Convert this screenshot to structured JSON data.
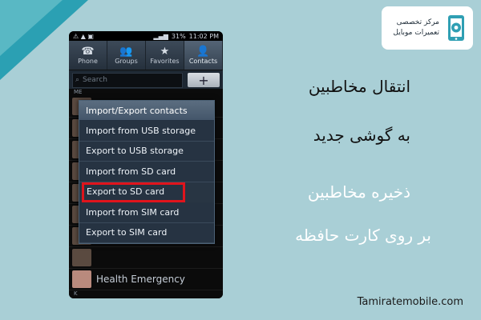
{
  "status": {
    "right_text": "11:02 PM",
    "battery": "31%"
  },
  "tabs": [
    {
      "label": "Phone",
      "icon": "phone-icon",
      "glyph": "☎"
    },
    {
      "label": "Groups",
      "icon": "groups-icon",
      "glyph": "👥"
    },
    {
      "label": "Favorites",
      "icon": "star-icon",
      "glyph": "★"
    },
    {
      "label": "Contacts",
      "icon": "contact-icon",
      "glyph": "👤"
    }
  ],
  "search": {
    "placeholder": "Search",
    "add_label": "+"
  },
  "list": {
    "header_me": "ME",
    "header_k": "K",
    "contact": "Health Emergency"
  },
  "menu": {
    "title": "Import/Export contacts",
    "items": [
      "Import from USB storage",
      "Export to USB storage",
      "Import from SD card",
      "Export to SD card",
      "Import from SIM card",
      "Export to SIM card"
    ]
  },
  "headline": {
    "line1": "انتقال مخاطبین",
    "line2": "به گوشی جدید",
    "line3": "ذخیره مخاطبین",
    "line4": "بر روی کارت حافظه"
  },
  "logo": {
    "line1": "مرکز تخصصی",
    "line2": "تعمیرات موبایل"
  },
  "site": "Tamiratemobile.com",
  "colors": {
    "background": "#a9cfd6",
    "highlight": "#e0141c",
    "menu_bg": "#263342"
  }
}
